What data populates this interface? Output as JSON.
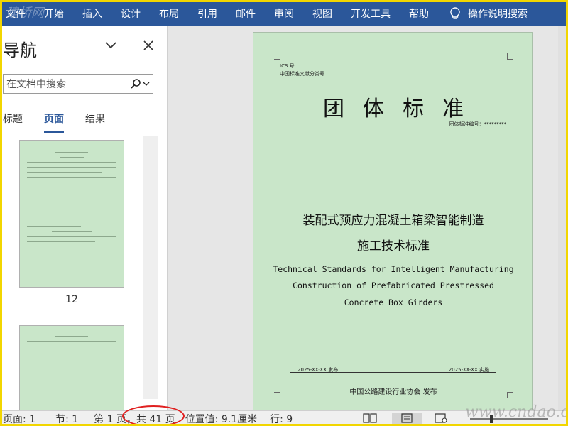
{
  "ribbon": {
    "tabs": [
      "文件",
      "开始",
      "插入",
      "设计",
      "布局",
      "引用",
      "邮件",
      "审阅",
      "视图",
      "开发工具",
      "帮助"
    ],
    "tell_me": "操作说明搜索"
  },
  "watermark_top": "建桥网",
  "nav": {
    "title": "导航",
    "search_placeholder": "在文档中搜索",
    "tabs": [
      "标题",
      "页面",
      "结果"
    ],
    "active_tab": "页面",
    "thumb_label": "12"
  },
  "page": {
    "ics": "ICS 号",
    "class_no": "中国标准文献分类号",
    "heading": "团体标准",
    "std_no": "团体标准编号：*********",
    "title_cn_1": "装配式预应力混凝土箱梁智能制造",
    "title_cn_2": "施工技术标准",
    "title_en_1": "Technical Standards for Intelligent Manufacturing",
    "title_en_2": "Construction of Prefabricated Prestressed",
    "title_en_3": "Concrete Box Girders",
    "publish": "2025-XX-XX 发布",
    "implement": "2025-XX-XX 实施",
    "issuer": "中国公路建设行业协会 发布"
  },
  "status": {
    "page": "页面: 1",
    "section": "节: 1",
    "page_of": "第 1 页，",
    "total": "共 41 页",
    "position": "位置值: 9.1厘米",
    "line": "行: 9"
  },
  "watermark_bottom": "www.cndao.com",
  "colors": {
    "ribbon": "#2b579a",
    "page": "#c9e6c9",
    "highlight": "#e02020",
    "frame": "#f2d600"
  }
}
